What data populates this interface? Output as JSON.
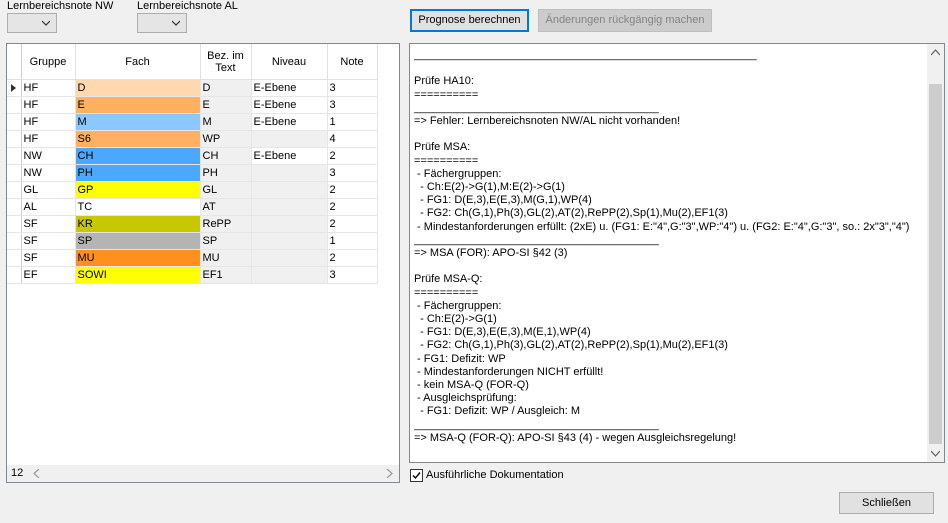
{
  "filters": {
    "nw_label": "Lernbereichsnote NW",
    "al_label": "Lernbereichsnote AL",
    "nw_value": "",
    "al_value": ""
  },
  "buttons": {
    "prognose": "Prognose berechnen",
    "undo": "Änderungen rückgängig machen",
    "close": "Schließen"
  },
  "grid": {
    "headers": {
      "gruppe": "Gruppe",
      "fach": "Fach",
      "bez": "Bez. im Text",
      "niveau": "Niveau",
      "note": "Note"
    },
    "rows": [
      {
        "gruppe": "HF",
        "fach": "D",
        "color": "#ffd8b0",
        "bez": "D",
        "niveau": "E-Ebene",
        "note": "3"
      },
      {
        "gruppe": "HF",
        "fach": "E",
        "color": "#ffb060",
        "bez": "E",
        "niveau": "E-Ebene",
        "note": "3"
      },
      {
        "gruppe": "HF",
        "fach": "M",
        "color": "#8cc8ff",
        "bez": "M",
        "niveau": "E-Ebene",
        "note": "1"
      },
      {
        "gruppe": "HF",
        "fach": "S6",
        "color": "#ffb060",
        "bez": "WP",
        "niveau": "",
        "note": "4"
      },
      {
        "gruppe": "NW",
        "fach": "CH",
        "color": "#4aa8ff",
        "bez": "CH",
        "niveau": "E-Ebene",
        "note": "2"
      },
      {
        "gruppe": "NW",
        "fach": "PH",
        "color": "#4aa8ff",
        "bez": "PH",
        "niveau": "",
        "note": "3"
      },
      {
        "gruppe": "GL",
        "fach": "GP",
        "color": "#ffff00",
        "bez": "GL",
        "niveau": "",
        "note": "2"
      },
      {
        "gruppe": "AL",
        "fach": "TC",
        "color": "#ffffff",
        "bez": "AT",
        "niveau": "",
        "note": "2"
      },
      {
        "gruppe": "SF",
        "fach": "KR",
        "color": "#c8c800",
        "bez": "RePP",
        "niveau": "",
        "note": "2"
      },
      {
        "gruppe": "SF",
        "fach": "SP",
        "color": "#b4b4b4",
        "bez": "SP",
        "niveau": "",
        "note": "1"
      },
      {
        "gruppe": "SF",
        "fach": "MU",
        "color": "#ff9020",
        "bez": "MU",
        "niveau": "",
        "note": "2"
      },
      {
        "gruppe": "EF",
        "fach": "SOWI",
        "color": "#ffff00",
        "bez": "EF1",
        "niveau": "",
        "note": "3"
      }
    ],
    "row_count": "12"
  },
  "log": {
    "text": "________________________________________________________\n\nPrüfe HA10:\n==========\n________________________________________\n=> Fehler: Lernbereichsnoten NW/AL nicht vorhanden!\n\nPrüfe MSA:\n==========\n - Fächergruppen:\n  - Ch:E(2)->G(1),M:E(2)->G(1)\n  - FG1: D(E,3),E(E,3),M(G,1),WP(4)\n  - FG2: Ch(G,1),Ph(3),GL(2),AT(2),RePP(2),Sp(1),Mu(2),EF1(3)\n - Mindestanforderungen erfüllt: (2xE) u. (FG1: E:\"4\",G:\"3\",WP:\"4\") u. (FG2: E:\"4\",G:\"3\", so.: 2x\"3\",\"4\")\n________________________________________\n=> MSA (FOR): APO-SI §42 (3)\n\nPrüfe MSA-Q:\n==========\n - Fächergruppen:\n  - Ch:E(2)->G(1)\n  - FG1: D(E,3),E(E,3),M(E,1),WP(4)\n  - FG2: Ch(G,1),Ph(3),GL(2),AT(2),RePP(2),Sp(1),Mu(2),EF1(3)\n - FG1: Defizit: WP\n - Mindestanforderungen NICHT erfüllt!\n - kein MSA-Q (FOR-Q)\n - Ausgleichsprüfung:\n  - FG1: Defizit: WP / Ausgleich: M\n________________________________________\n=> MSA-Q (FOR-Q): APO-SI §43 (4) - wegen Ausgleichsregelung!"
  },
  "options": {
    "detail_label": "Ausführliche Dokumentation",
    "detail_checked": true
  }
}
